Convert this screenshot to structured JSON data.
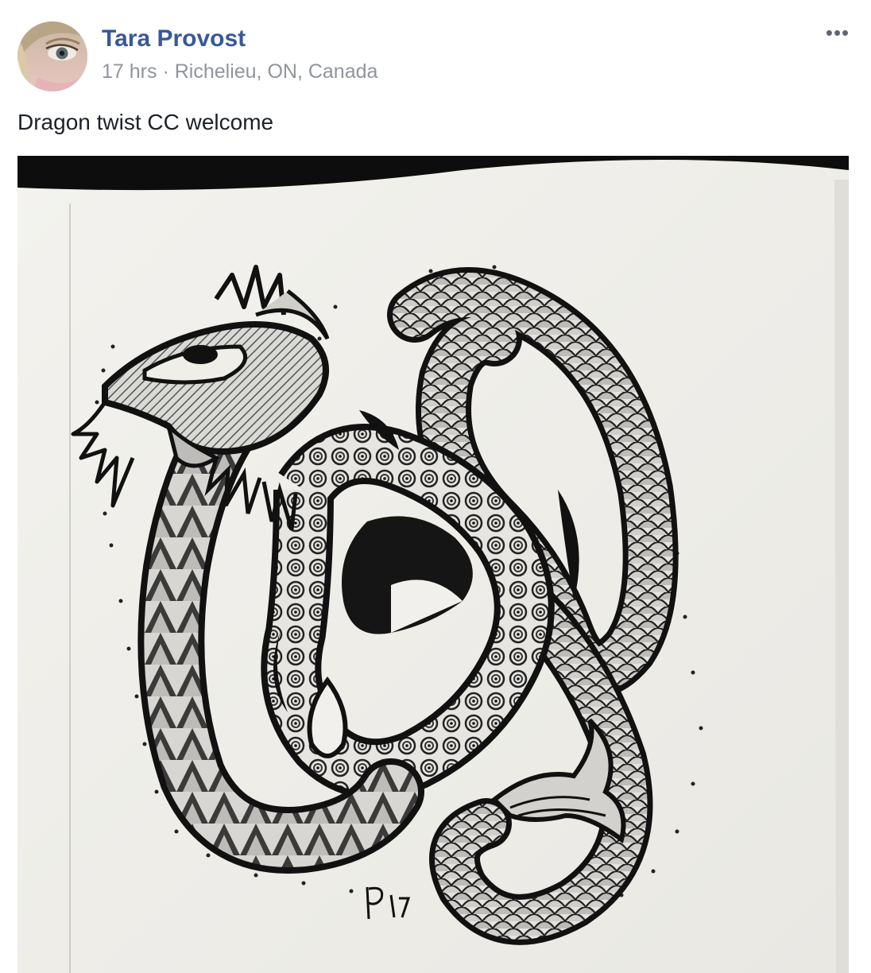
{
  "post": {
    "author": "Tara Provost",
    "time": "17 hrs",
    "separator": "·",
    "location": "Richelieu, ON, Canada",
    "caption": "Dragon twist CC welcome",
    "more_label": "•••"
  },
  "photo": {
    "icon": "dragon-drawing-photo",
    "signature_text": "P17"
  },
  "avatar": {
    "icon": "profile-photo-avatar"
  }
}
